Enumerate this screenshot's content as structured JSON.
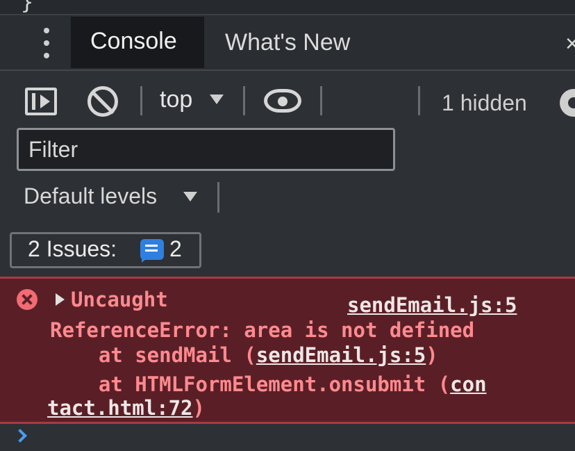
{
  "tabs": {
    "active": "Console",
    "other": "What's New"
  },
  "toolbar": {
    "context": "top",
    "hidden_count": "1 hidden"
  },
  "filter": {
    "placeholder": "Filter"
  },
  "levels": {
    "label": "Default levels"
  },
  "issues": {
    "label": "2 Issues:",
    "count": "2"
  },
  "error": {
    "title": "Uncaught",
    "source_link": "sendEmail.js:5",
    "message": "ReferenceError: area is not defined",
    "stack_1_prefix": "    at sendMail (",
    "stack_1_link": "sendEmail.js:5",
    "stack_1_suffix": ")",
    "stack_2_prefix": "    at HTMLFormElement.onsubmit (",
    "stack_2_link_a": "con",
    "stack_2_link_b": "tact.html:72",
    "stack_2_suffix": ")"
  },
  "colors": {
    "error_text": "#ff8a90",
    "error_bg": "#5a1f26",
    "issue_accent": "#2f7fe0",
    "prompt_accent": "#4a9cf0"
  },
  "icons": [
    "brace-icon",
    "kebab-menu-icon",
    "close-icon",
    "sidebar-toggle-icon",
    "clear-console-icon",
    "dropdown-caret-icon",
    "eye-icon",
    "gear-icon",
    "issue-message-icon",
    "error-icon",
    "expand-triangle-icon",
    "prompt-chevron-icon"
  ]
}
